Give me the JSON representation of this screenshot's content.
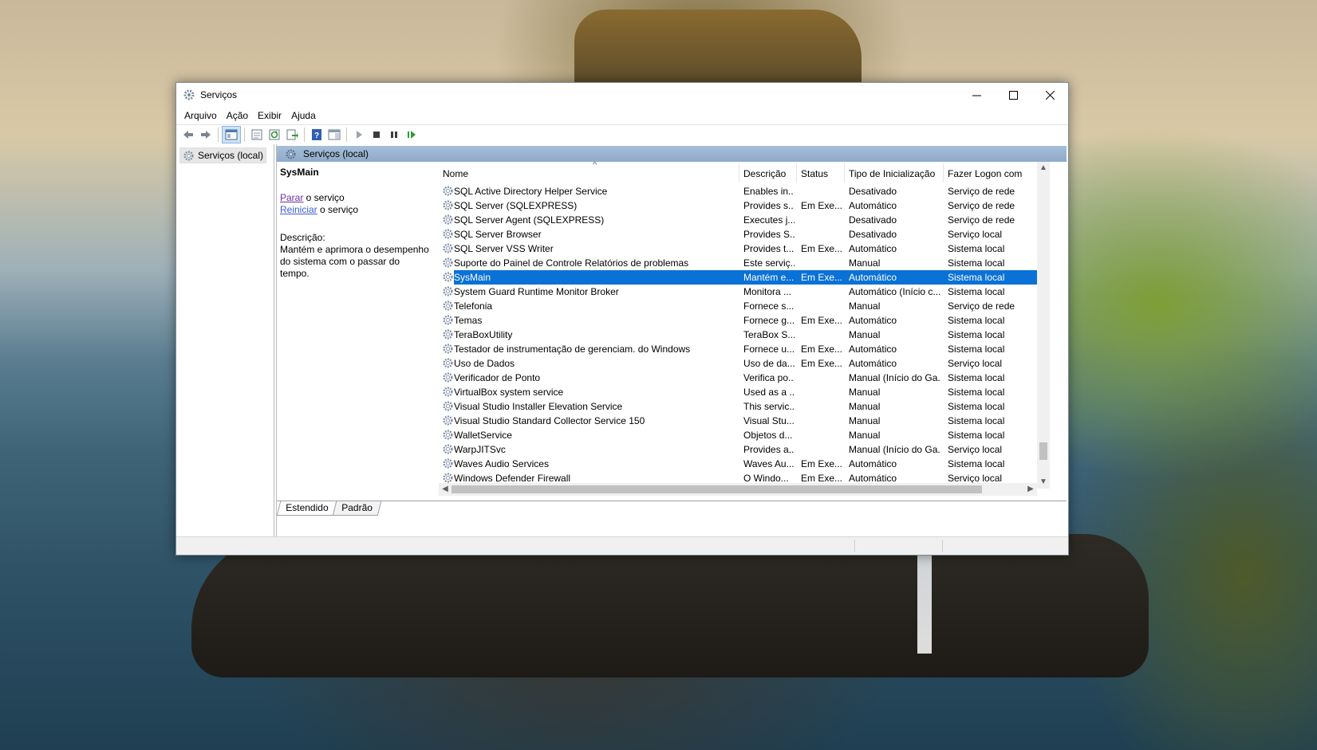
{
  "window": {
    "title": "Serviços"
  },
  "menu": [
    "Arquivo",
    "Ação",
    "Exibir",
    "Ajuda"
  ],
  "toolbar_icons": [
    "back-icon",
    "forward-icon",
    "show-hide-console-tree-icon",
    "properties-icon",
    "refresh-icon",
    "export-list-icon",
    "help-icon",
    "show-hide-action-pane-icon",
    "start-service-icon",
    "stop-service-icon",
    "pause-service-icon",
    "restart-service-icon"
  ],
  "tree": {
    "root_label": "Serviços (local)"
  },
  "pane": {
    "header": "Serviços (local)",
    "selected_service": "SysMain",
    "stop_link": "Parar",
    "stop_suffix": " o serviço",
    "restart_link": "Reiniciar",
    "restart_suffix": " o serviço",
    "description_label": "Descrição:",
    "description_text": "Mantém e aprimora o desempenho do sistema com o passar do tempo."
  },
  "columns": [
    "Nome",
    "Descrição",
    "Status",
    "Tipo de Inicialização",
    "Fazer Logon com"
  ],
  "rows": [
    [
      "SQL Active Directory Helper Service",
      "Enables in...",
      "",
      "Desativado",
      "Serviço de rede"
    ],
    [
      "SQL Server (SQLEXPRESS)",
      "Provides s...",
      "Em Exe...",
      "Automático",
      "Serviço de rede"
    ],
    [
      "SQL Server Agent (SQLEXPRESS)",
      "Executes j...",
      "",
      "Desativado",
      "Serviço de rede"
    ],
    [
      "SQL Server Browser",
      "Provides S...",
      "",
      "Desativado",
      "Serviço local"
    ],
    [
      "SQL Server VSS Writer",
      "Provides t...",
      "Em Exe...",
      "Automático",
      "Sistema local"
    ],
    [
      "Suporte do Painel de Controle Relatórios de problemas",
      "Este serviç...",
      "",
      "Manual",
      "Sistema local"
    ],
    [
      "SysMain",
      "Mantém e...",
      "Em Exe...",
      "Automático",
      "Sistema local"
    ],
    [
      "System Guard Runtime Monitor Broker",
      "Monitora ...",
      "",
      "Automático (Início c...",
      "Sistema local"
    ],
    [
      "Telefonia",
      "Fornece s...",
      "",
      "Manual",
      "Serviço de rede"
    ],
    [
      "Temas",
      "Fornece g...",
      "Em Exe...",
      "Automático",
      "Sistema local"
    ],
    [
      "TeraBoxUtility",
      "TeraBox S...",
      "",
      "Manual",
      "Sistema local"
    ],
    [
      "Testador de instrumentação de gerenciam. do Windows",
      "Fornece u...",
      "Em Exe...",
      "Automático",
      "Sistema local"
    ],
    [
      "Uso de Dados",
      "Uso de da...",
      "Em Exe...",
      "Automático",
      "Serviço local"
    ],
    [
      "Verificador de Ponto",
      "Verifica po...",
      "",
      "Manual (Início do Ga...",
      "Sistema local"
    ],
    [
      "VirtualBox system service",
      "Used as a ...",
      "",
      "Manual",
      "Sistema local"
    ],
    [
      "Visual Studio Installer Elevation Service",
      "This servic...",
      "",
      "Manual",
      "Sistema local"
    ],
    [
      "Visual Studio Standard Collector Service 150",
      "Visual Stu...",
      "",
      "Manual",
      "Sistema local"
    ],
    [
      "WalletService",
      "Objetos d...",
      "",
      "Manual",
      "Sistema local"
    ],
    [
      "WarpJITSvc",
      "Provides a...",
      "",
      "Manual (Início do Ga...",
      "Serviço local"
    ],
    [
      "Waves Audio Services",
      "Waves Au...",
      "Em Exe...",
      "Automático",
      "Sistema local"
    ],
    [
      "Windows Defender Firewall",
      "O Windo...",
      "Em Exe...",
      "Automático",
      "Serviço local"
    ]
  ],
  "selected_row": 6,
  "tabs": [
    "Estendido",
    "Padrão"
  ],
  "colors": {
    "selection": "#0a72d6",
    "pane_header": "#9db6d2"
  }
}
